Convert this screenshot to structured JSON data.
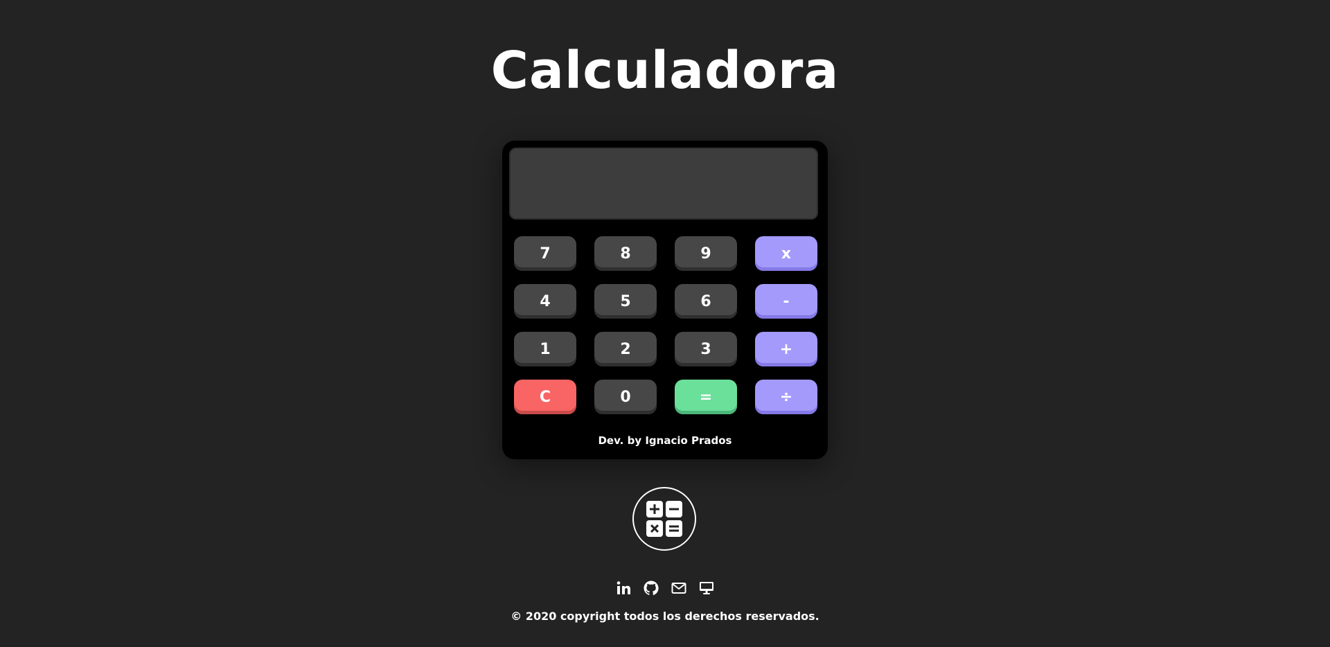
{
  "page": {
    "title": "Calculadora"
  },
  "calculator": {
    "display_value": "",
    "rows": [
      [
        {
          "label": "7",
          "kind": "num"
        },
        {
          "label": "8",
          "kind": "num"
        },
        {
          "label": "9",
          "kind": "num"
        },
        {
          "label": "x",
          "kind": "op"
        }
      ],
      [
        {
          "label": "4",
          "kind": "num"
        },
        {
          "label": "5",
          "kind": "num"
        },
        {
          "label": "6",
          "kind": "num"
        },
        {
          "label": "-",
          "kind": "op"
        }
      ],
      [
        {
          "label": "1",
          "kind": "num"
        },
        {
          "label": "2",
          "kind": "num"
        },
        {
          "label": "3",
          "kind": "num"
        },
        {
          "label": "+",
          "kind": "op"
        }
      ],
      [
        {
          "label": "C",
          "kind": "clear"
        },
        {
          "label": "0",
          "kind": "num"
        },
        {
          "label": "=",
          "kind": "equals"
        },
        {
          "label": "÷",
          "kind": "op"
        }
      ]
    ],
    "credit": "Dev. by Ignacio Prados"
  },
  "logo": {
    "icon": "calculator-logo-icon"
  },
  "social": [
    {
      "icon": "linkedin-icon"
    },
    {
      "icon": "github-icon"
    },
    {
      "icon": "mail-icon"
    },
    {
      "icon": "monitor-icon"
    }
  ],
  "footer": {
    "copyright": "© 2020 copyright todos los derechos reservados."
  },
  "colors": {
    "background": "#232323",
    "number_key": "#474747",
    "operator_key": "#a49afb",
    "clear_key": "#f96565",
    "equals_key": "#6be09b"
  }
}
